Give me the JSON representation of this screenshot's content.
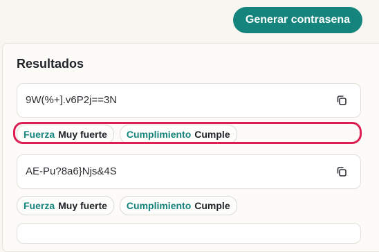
{
  "header": {
    "generate_label": "Generar contrasena"
  },
  "results": {
    "title": "Resultados",
    "items": [
      {
        "password": "9W(%+].v6P2j==3N",
        "strength_label": "Fuerza",
        "strength_value": "Muy fuerte",
        "compliance_label": "Cumplimiento",
        "compliance_value": "Cumple",
        "highlighted": true
      },
      {
        "password": "AE-Pu?8a6}Njs&4S",
        "strength_label": "Fuerza",
        "strength_value": "Muy fuerte",
        "compliance_label": "Cumplimiento",
        "compliance_value": "Cumple",
        "highlighted": false
      }
    ]
  },
  "colors": {
    "accent": "#14847d",
    "highlight": "#dc1e52",
    "background": "#f7f6f1"
  },
  "icons": {
    "copy": "copy-icon"
  }
}
